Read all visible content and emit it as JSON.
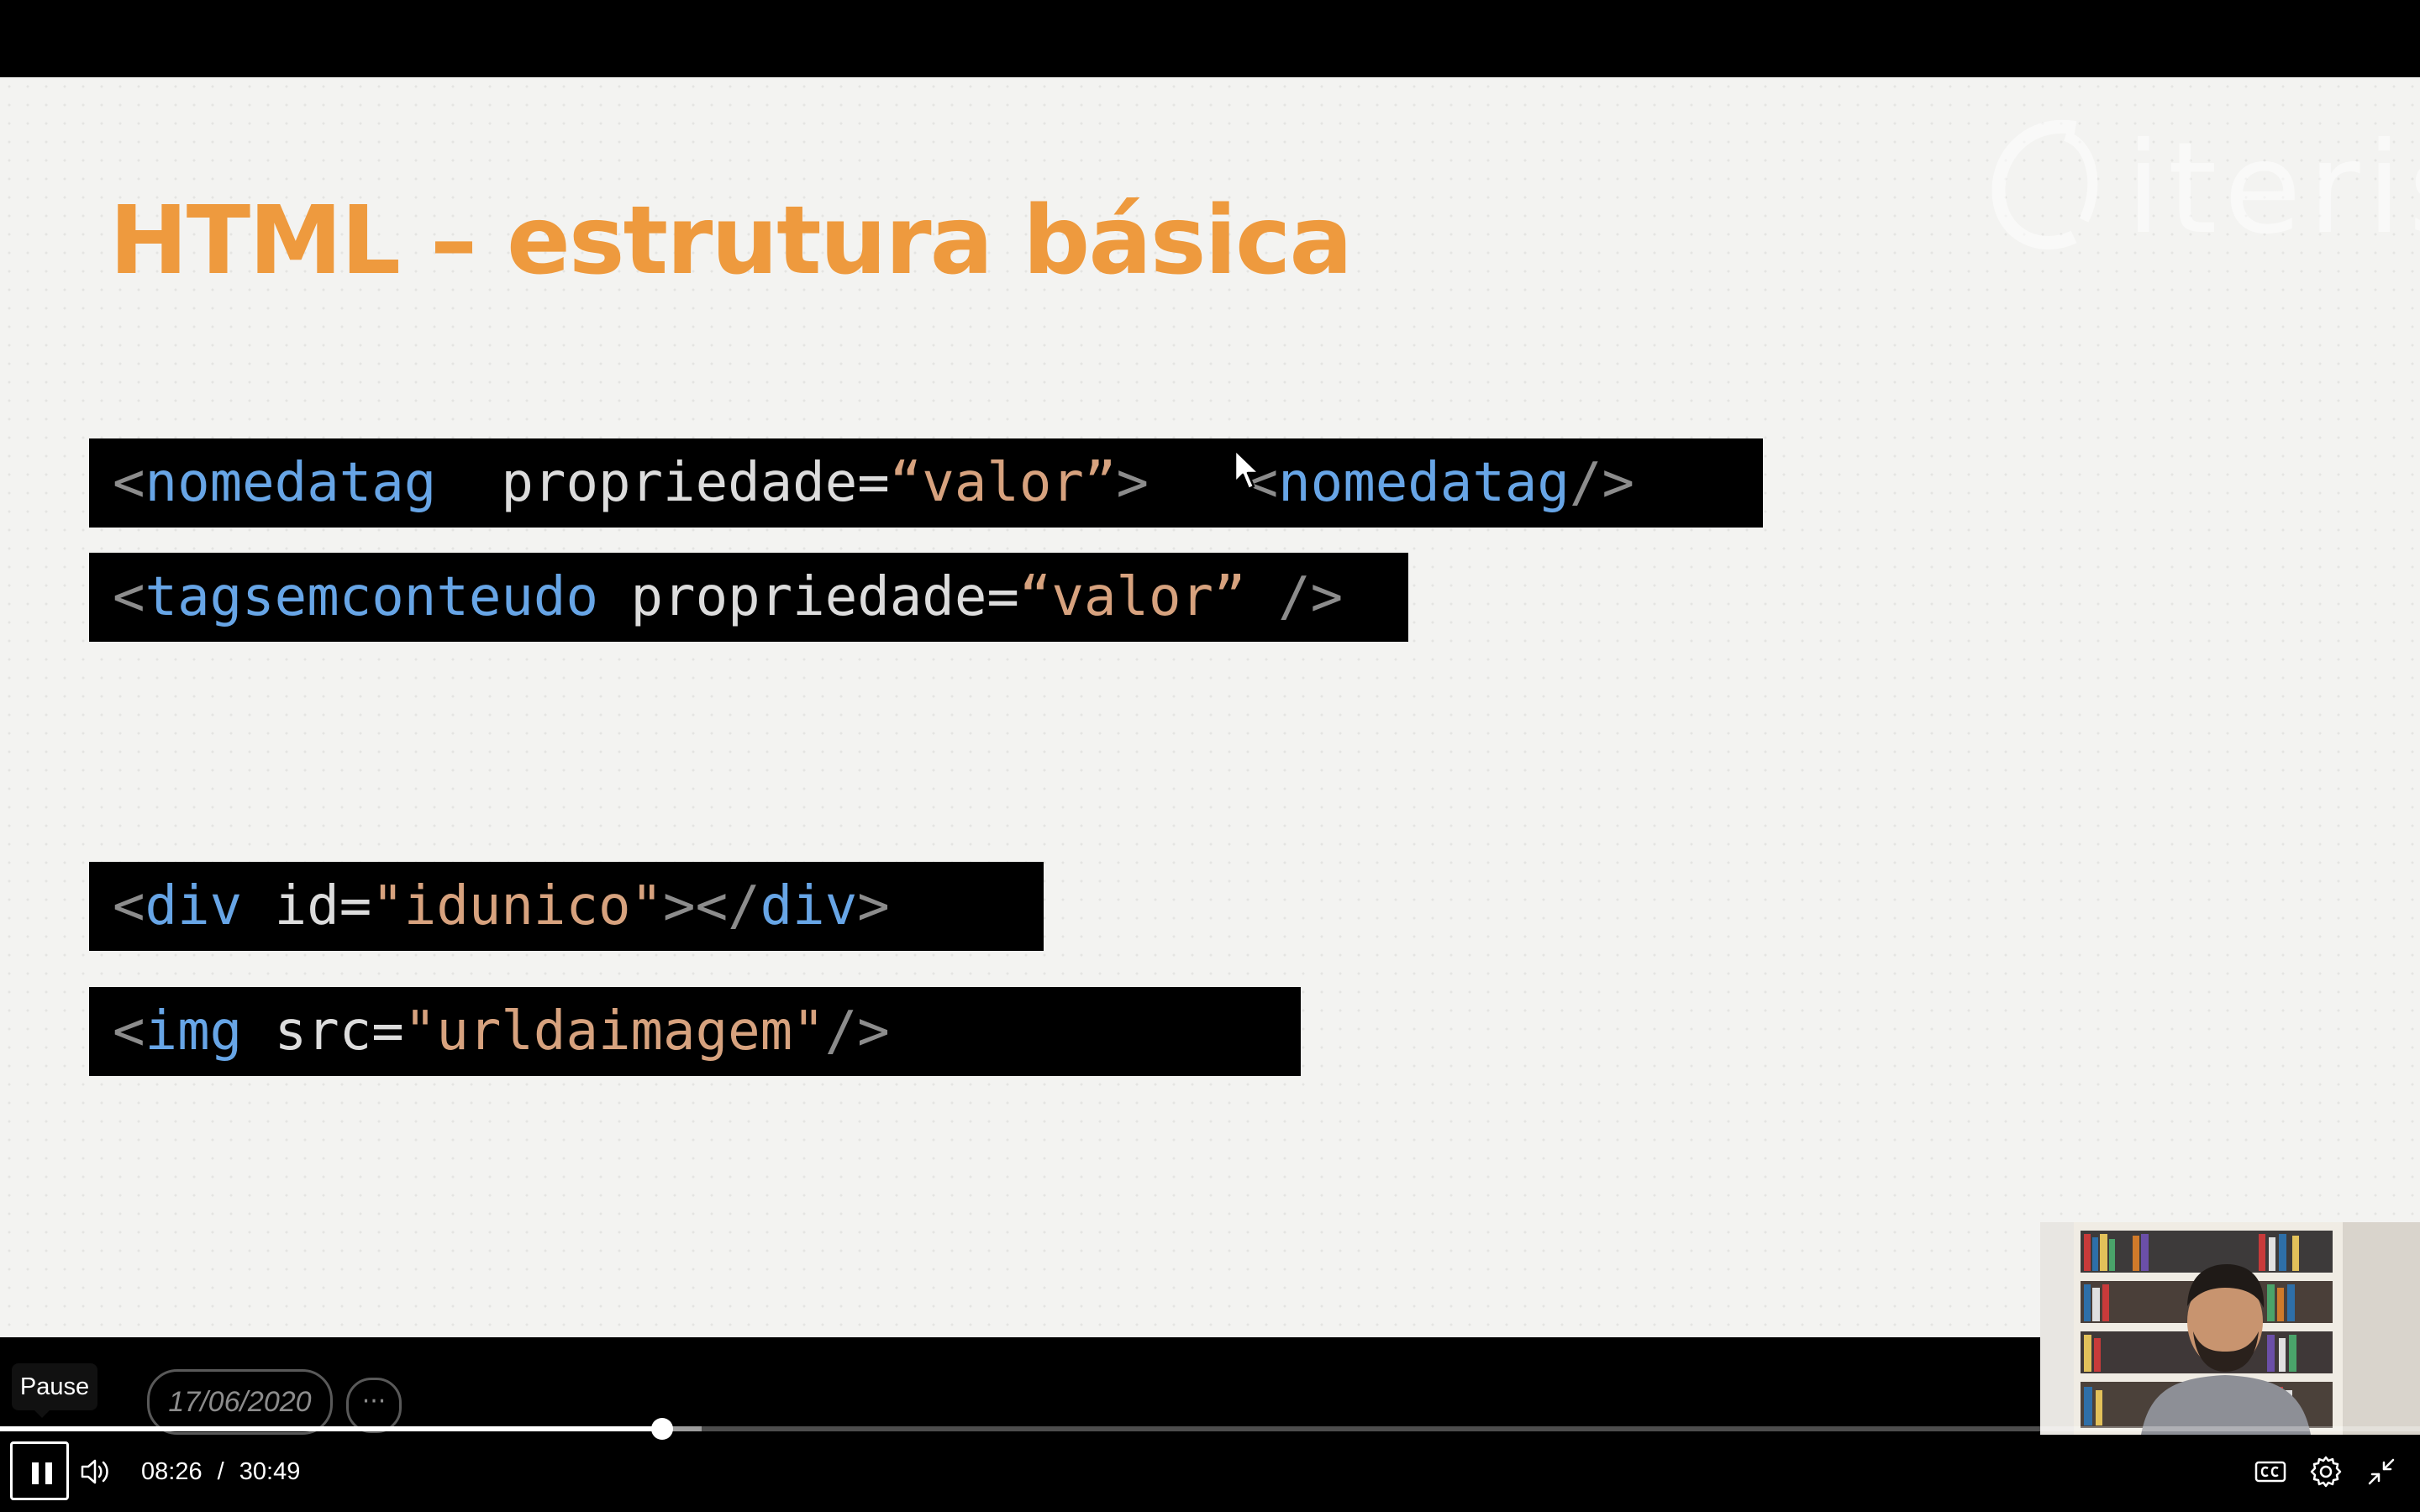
{
  "slide": {
    "title": "HTML – estrutura básica",
    "logo_text": "iteris",
    "code_lines": [
      [
        {
          "cls": "p",
          "text": "<"
        },
        {
          "cls": "t",
          "text": "nomedatag"
        },
        {
          "cls": "a",
          "text": "  propriedade="
        },
        {
          "cls": "v",
          "text": "“valor”"
        },
        {
          "cls": "p",
          "text": ">  "
        },
        {
          "cls": "p",
          "text": " <"
        },
        {
          "cls": "t",
          "text": "nomedatag"
        },
        {
          "cls": "p",
          "text": "/>"
        }
      ],
      [
        {
          "cls": "p",
          "text": "<"
        },
        {
          "cls": "t",
          "text": "tagsemconteudo"
        },
        {
          "cls": "a",
          "text": " propriedade="
        },
        {
          "cls": "v",
          "text": "“valor”"
        },
        {
          "cls": "p",
          "text": " />"
        }
      ],
      [
        {
          "cls": "p",
          "text": "<"
        },
        {
          "cls": "t",
          "text": "div"
        },
        {
          "cls": "a",
          "text": " id="
        },
        {
          "cls": "v",
          "text": "\"idunico\""
        },
        {
          "cls": "p",
          "text": "></"
        },
        {
          "cls": "t",
          "text": "div"
        },
        {
          "cls": "p",
          "text": ">"
        }
      ],
      [
        {
          "cls": "p",
          "text": "<"
        },
        {
          "cls": "t",
          "text": "img"
        },
        {
          "cls": "a",
          "text": " src="
        },
        {
          "cls": "v",
          "text": "\"urldaimagem\""
        },
        {
          "cls": "p",
          "text": "/>"
        }
      ]
    ],
    "date": "17/06/2020",
    "more": "···"
  },
  "player": {
    "tooltip": "Pause",
    "current_time": "08:26",
    "separator": "/",
    "duration": "30:49",
    "progress_fraction": 0.2736,
    "buffered_fraction": 0.29,
    "icons": {
      "play_pause": "pause-icon",
      "volume": "volume-icon",
      "captions": "closed-captions-icon",
      "settings": "gear-icon",
      "fullscreen": "exit-fullscreen-icon"
    }
  },
  "colors": {
    "title": "#ee9a3e",
    "band": "#eb9641",
    "code_tag": "#67a5e6",
    "code_value": "#d7a27e",
    "code_punct": "#8c8c8c",
    "code_attr": "#dcdcdc"
  }
}
